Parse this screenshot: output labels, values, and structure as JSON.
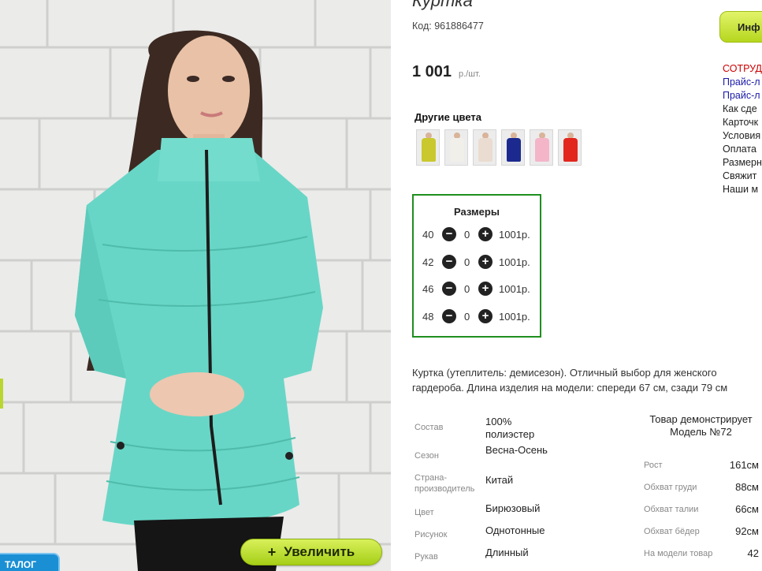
{
  "product": {
    "title": "Куртка",
    "code": "Код: 961886477",
    "price": "1 001",
    "price_unit": "р./шт."
  },
  "zoom_button": {
    "icon": "+",
    "label": "Увеличить"
  },
  "catalog_tab": {
    "label": "ТАЛОГ"
  },
  "colors": {
    "title": "Другие цвета",
    "swatches": [
      "#c9c82e",
      "#f1efe9",
      "#eadcd0",
      "#1c2a8f",
      "#f4b5c9",
      "#e2261e"
    ]
  },
  "sizes": {
    "title": "Размеры",
    "rows": [
      {
        "size": "40",
        "qty": "0",
        "price": "1001р."
      },
      {
        "size": "42",
        "qty": "0",
        "price": "1001р."
      },
      {
        "size": "46",
        "qty": "0",
        "price": "1001р."
      },
      {
        "size": "48",
        "qty": "0",
        "price": "1001р."
      }
    ]
  },
  "description": "Куртка (утеплитель: демисезон). Отличный выбор для женского гардероба. Длина изделия на модели: спереди 67 см, сзади 79 см",
  "specs": [
    {
      "k": "Состав",
      "v": "100% полиэстер"
    },
    {
      "k": "Сезон",
      "v": "Весна-Осень"
    },
    {
      "k": "Страна-производитель",
      "v": "Китай"
    },
    {
      "k": "Цвет",
      "v": "Бирюзовый"
    },
    {
      "k": "Рисунок",
      "v": "Однотонные"
    },
    {
      "k": "Рукав",
      "v": "Длинный"
    }
  ],
  "model": {
    "title": "Товар демонстрирует Модель №72",
    "rows": [
      {
        "k": "Рост",
        "v": "161см"
      },
      {
        "k": "Обхват груди",
        "v": "88см"
      },
      {
        "k": "Обхват талии",
        "v": "66см"
      },
      {
        "k": "Обхват бёдер",
        "v": "92см"
      },
      {
        "k": "На модели товар",
        "v": "42"
      }
    ]
  },
  "right_panel": {
    "info_button": "Инф",
    "links": [
      {
        "text": "СОТРУД",
        "color": "#cc0000"
      },
      {
        "text": "Прайс-л",
        "color": "#1a1aa8"
      },
      {
        "text": "Прайс-л",
        "color": "#1a1aa8"
      },
      {
        "text": "Как сде",
        "color": "#222222"
      },
      {
        "text": "Карточк",
        "color": "#222222"
      },
      {
        "text": "Условия",
        "color": "#222222"
      },
      {
        "text": "Оплата",
        "color": "#222222"
      },
      {
        "text": "Размерн",
        "color": "#222222"
      },
      {
        "text": "Свяжит",
        "color": "#222222"
      },
      {
        "text": "Наши м",
        "color": "#222222"
      }
    ]
  }
}
